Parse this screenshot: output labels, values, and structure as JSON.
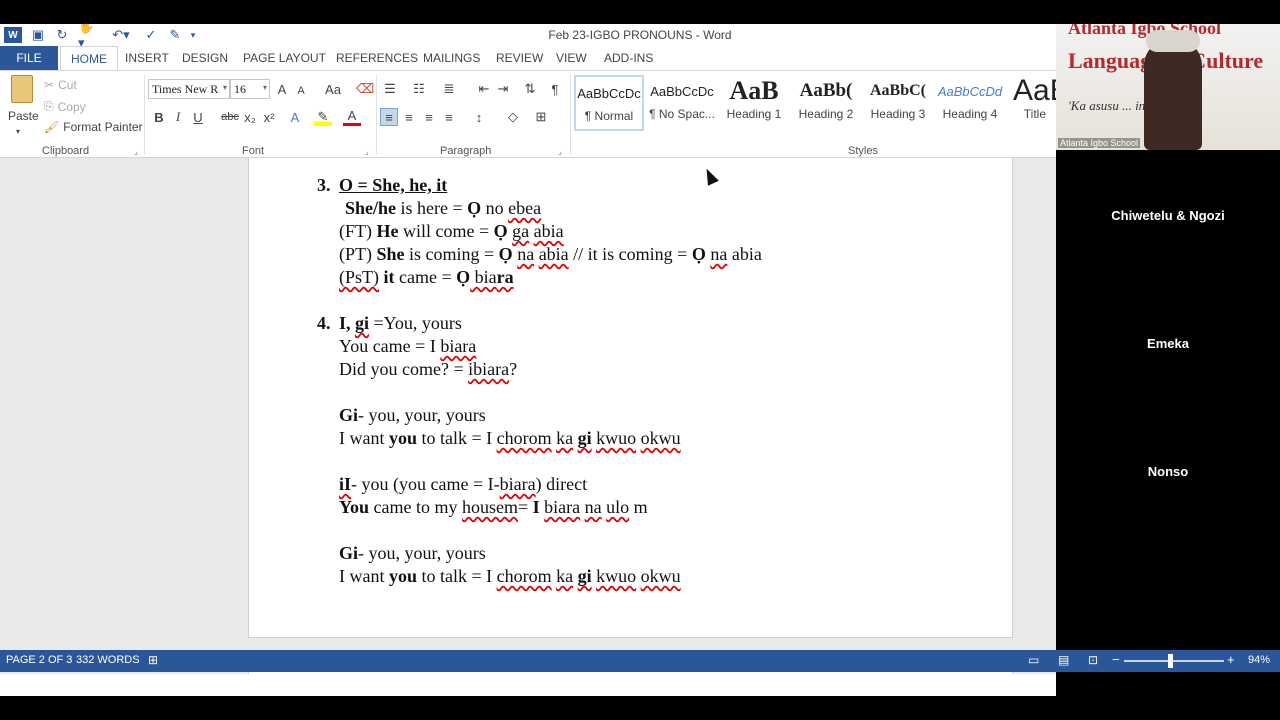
{
  "window": {
    "title": "Feb 23-IGBO PRONOUNS - Word"
  },
  "ribbon_tabs": [
    "FILE",
    "HOME",
    "INSERT",
    "DESIGN",
    "PAGE LAYOUT",
    "REFERENCES",
    "MAILINGS",
    "REVIEW",
    "VIEW",
    "ADD-INS"
  ],
  "clipboard": {
    "paste": "Paste",
    "cut": "Cut",
    "copy": "Copy",
    "format_painter": "Format Painter",
    "label": "Clipboard"
  },
  "font": {
    "name": "Times New R",
    "size": "16",
    "label": "Font",
    "grow": "A",
    "shrink": "A",
    "case": "Aa",
    "bold": "B",
    "italic": "I",
    "underline": "U",
    "strike": "abc",
    "sub": "x₂",
    "sup": "x²"
  },
  "paragraph": {
    "label": "Paragraph"
  },
  "styles": {
    "label": "Styles",
    "items": [
      {
        "preview": "AaBbCcDc",
        "name": "¶ Normal"
      },
      {
        "preview": "AaBbCcDc",
        "name": "¶ No Spac..."
      },
      {
        "preview": "AaB",
        "name": "Heading 1"
      },
      {
        "preview": "AaBb(",
        "name": "Heading 2"
      },
      {
        "preview": "AaBbC(",
        "name": "Heading 3"
      },
      {
        "preview": "AaBbCcDd",
        "name": "Heading 4"
      },
      {
        "preview": "AaB",
        "name": "Title"
      }
    ]
  },
  "document": {
    "s3_num": "3.",
    "s3_head": "O = She, he, it",
    "s3_l1a": "She/he",
    "s3_l1b": " is here = ",
    "s3_l1c": "Ọ",
    "s3_l1d": " no ",
    "s3_l1e": "ebea",
    "s3_l2a": "(FT) ",
    "s3_l2b": "He",
    "s3_l2c": " will come = ",
    "s3_l2d": "Ọ",
    "s3_l2e": " ",
    "s3_l2f": "ga",
    "s3_l2g": " ",
    "s3_l2h": "abia",
    "s3_l3a": "(PT) ",
    "s3_l3b": "She",
    "s3_l3c": " is coming = ",
    "s3_l3d": "Ọ",
    "s3_l3e": " ",
    "s3_l3f": "na",
    "s3_l3g": " ",
    "s3_l3h": "abia",
    "s3_l3i": "  // it is coming = ",
    "s3_l3j": "Ọ",
    "s3_l3k": " ",
    "s3_l3l": "na",
    "s3_l3m": " abia",
    "s3_l4a": "(PsT)",
    "s3_l4b": " ",
    "s3_l4c": "it",
    "s3_l4d": " came = ",
    "s3_l4e": "Ọ",
    "s3_l4f": " bia",
    "s3_l4g": "ra",
    "s4_num": "4.",
    "s4_head_a": "I,  ",
    "s4_head_b": "gi",
    "s4_head_c": " =You, yours",
    "s4_l1a": "You came = I ",
    "s4_l1b": "biara",
    "s4_l2a": "Did you come?  = ",
    "s4_l2b": "ibiara",
    "s4_l2c": "?",
    "gi_a": "Gi",
    "gi_b": "- you, your, yours",
    "want_a": "I want ",
    "want_b": "you",
    "want_c": " to talk = I ",
    "want_d": "chorom",
    "want_e": " ",
    "want_f": "ka",
    "want_g": " ",
    "want_h": "gi",
    "want_i": " ",
    "want_j": "kwuo",
    "want_k": " ",
    "want_l": "okwu",
    "ii_a": "iI",
    "ii_b": "- you (you came = I-",
    "ii_c": "biara",
    "ii_d": ") direct",
    "came_a": "You",
    "came_b": " came to my ",
    "came_c": "housem",
    "came_d": "= ",
    "came_e": "I",
    "came_f": " ",
    "came_g": "biara",
    "came_h": " ",
    "came_i": "na",
    "came_j": " ",
    "came_k": "ulo",
    "came_l": " m"
  },
  "status": {
    "page": "PAGE 2 OF 3",
    "words": "332 WORDS",
    "zoom": "94%"
  },
  "video": {
    "host_label": "Atlanta Igbo School",
    "banner_top": "Atlanta Igbo School",
    "banner_mid": "Language & Culture",
    "banner_bot": "'Ka asusu ... inwu'",
    "participants": [
      "Chiwetelu & Ngozi",
      "Emeka",
      "Nonso"
    ]
  }
}
